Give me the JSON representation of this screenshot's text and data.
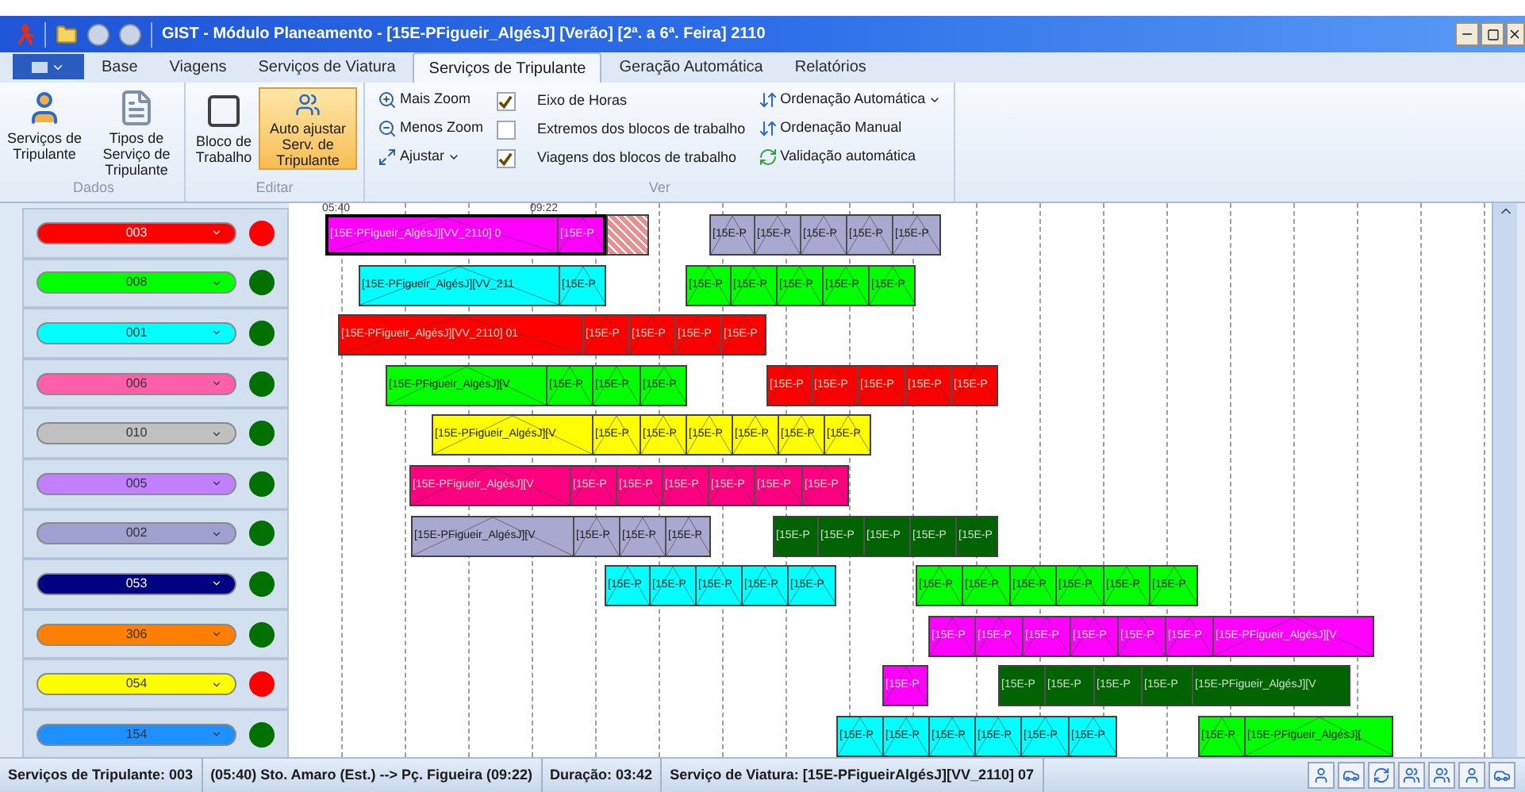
{
  "window": {
    "title": "GIST - Módulo Planeamento - [15E-PFigueir_AlgésJ] [Verão] [2ª. a 6ª. Feira] 2110"
  },
  "tabs": [
    {
      "label": "Base",
      "selected": false
    },
    {
      "label": "Viagens",
      "selected": false
    },
    {
      "label": "Serviços de Viatura",
      "selected": false
    },
    {
      "label": "Serviços de Tripulante",
      "selected": true
    },
    {
      "label": "Geração Automática",
      "selected": false
    },
    {
      "label": "Relatórios",
      "selected": false
    }
  ],
  "data_group": {
    "label": "Dados",
    "buttons": [
      {
        "label": "Serviços de Tripulante"
      },
      {
        "label": "Tipos de Serviço de Tripulante"
      }
    ]
  },
  "edit_group": {
    "label": "Editar",
    "buttons": [
      {
        "label": "Bloco de Trabalho",
        "selected": false
      },
      {
        "label": "Auto ajustar Serv. de Tripulante",
        "selected": true
      }
    ]
  },
  "view_group": {
    "label": "Ver",
    "tools": [
      {
        "label": "Mais Zoom",
        "menu": false
      },
      {
        "label": "Menos Zoom",
        "menu": false
      },
      {
        "label": "Ajustar",
        "menu": true
      }
    ],
    "options": [
      {
        "label": "Eixo de Horas",
        "checked": true
      },
      {
        "label": "Extremos dos blocos de trabalho",
        "checked": false
      },
      {
        "label": "Viagens dos blocos de trabalho",
        "checked": true
      }
    ],
    "commands": [
      {
        "label": "Ordenação Automática",
        "menu": true
      },
      {
        "label": "Ordenação Manual",
        "menu": false
      },
      {
        "label": "Validação automática",
        "menu": false
      }
    ]
  },
  "timeline": {
    "marks": [
      "05:40",
      "09:22"
    ]
  },
  "crew_rows": [
    {
      "label": "003",
      "color": "#ff0000",
      "status": {
        "color": "#ff0000"
      },
      "blocks": [
        {
          "kind": "trips",
          "color": "#ff00ff",
          "selected": true,
          "segments": [
            "[15E-PFigueir_AlgésJ][VV_2110] 0",
            "[15E-P"
          ]
        },
        {
          "kind": "hatched",
          "color": "#e89090",
          "selected": false
        },
        {
          "kind": "trips",
          "color": "#a8a8d0",
          "selected": false,
          "segments": [
            "[15E-P",
            "[15E-P",
            "[15E-P",
            "[15E-P",
            "[15E-P"
          ]
        }
      ]
    },
    {
      "label": "008",
      "color": "#00ff00",
      "status": {
        "color": "#007000"
      },
      "blocks": [
        {
          "kind": "trips",
          "color": "#00ffff",
          "selected": false,
          "segments": [
            "[15E-PFigueir_AlgésJ][VV_211",
            "[15E-P"
          ]
        },
        {
          "kind": "trips",
          "color": "#00ff00",
          "selected": false,
          "segments": [
            "[15E-P",
            "[15E-P",
            "[15E-P",
            "[15E-P",
            "[15E-P"
          ]
        }
      ]
    },
    {
      "label": "001",
      "color": "#00ffff",
      "status": {
        "color": "#007000"
      },
      "blocks": [
        {
          "kind": "trips",
          "color": "#ff0000",
          "selected": false,
          "segments": [
            "[15E-PFigueir_AlgésJ][VV_2110] 01",
            "[15E-P",
            "[15E-P",
            "[15E-P",
            "[15E-P"
          ]
        }
      ]
    },
    {
      "label": "006",
      "color": "#ff5fa8",
      "status": {
        "color": "#007000"
      },
      "blocks": [
        {
          "kind": "trips",
          "color": "#00ff00",
          "selected": false,
          "segments": [
            "[15E-PFigueir_AlgésJ][V",
            "[15E-P",
            "[15E-P",
            "[15E-P"
          ]
        },
        {
          "kind": "trips",
          "color": "#ff0000",
          "selected": false,
          "segments": [
            "[15E-P",
            "[15E-P",
            "[15E-P",
            "[15E-P",
            "[15E-P"
          ]
        }
      ]
    },
    {
      "label": "010",
      "color": "#c0c0c0",
      "status": {
        "color": "#007000"
      },
      "blocks": [
        {
          "kind": "trips",
          "color": "#ffff00",
          "selected": false,
          "segments": [
            "[15E-PFigueir_AlgésJ][V",
            "[15E-P",
            "[15E-P",
            "[15E-P",
            "[15E-P",
            "[15E-P",
            "[15E-P"
          ]
        }
      ]
    },
    {
      "label": "005",
      "color": "#c080ff",
      "status": {
        "color": "#007000"
      },
      "blocks": [
        {
          "kind": "trips",
          "color": "#ff0080",
          "selected": false,
          "segments": [
            "[15E-PFigueir_AlgésJ][V",
            "[15E-P",
            "[15E-P",
            "[15E-P",
            "[15E-P",
            "[15E-P",
            "[15E-P"
          ]
        }
      ]
    },
    {
      "label": "002",
      "color": "#a0a0d0",
      "status": {
        "color": "#007000"
      },
      "blocks": [
        {
          "kind": "trips",
          "color": "#a8a8d0",
          "selected": false,
          "segments": [
            "[15E-PFigueir_AlgésJ][V",
            "[15E-P",
            "[15E-P",
            "[15E-P"
          ]
        },
        {
          "kind": "trips",
          "color": "#006400",
          "selected": false,
          "segments": [
            "[15E-P",
            "[15E-P",
            "[15E-P",
            "[15E-P",
            "[15E-P"
          ]
        }
      ]
    },
    {
      "label": "053",
      "color": "#000080",
      "status": {
        "color": "#007000"
      },
      "blocks": [
        {
          "kind": "trips",
          "color": "#00ffff",
          "selected": false,
          "segments": [
            "[15E-P",
            "[15E-P",
            "[15E-P",
            "[15E-P",
            "[15E-P"
          ]
        },
        {
          "kind": "trips",
          "color": "#00ff00",
          "selected": false,
          "segments": [
            "[15E-P",
            "[15E-P",
            "[15E-P",
            "[15E-P",
            "[15E-P",
            "[15E-P"
          ]
        }
      ]
    },
    {
      "label": "306",
      "color": "#ff8000",
      "status": {
        "color": "#007000"
      },
      "blocks": [
        {
          "kind": "trips",
          "color": "#ff00ff",
          "selected": false,
          "segments": [
            "[15E-P",
            "[15E-P",
            "[15E-P",
            "[15E-P",
            "[15E-P",
            "[15E-P",
            "[15E-PFigueir_AlgésJ][V"
          ]
        }
      ]
    },
    {
      "label": "054",
      "color": "#ffff00",
      "status": {
        "color": "#ff0000"
      },
      "blocks": [
        {
          "kind": "trips",
          "color": "#ff00ff",
          "selected": false,
          "segments": [
            "[15E-P"
          ]
        },
        {
          "kind": "trips",
          "color": "#006400",
          "selected": false,
          "segments": [
            "[15E-P",
            "[15E-P",
            "[15E-P",
            "[15E-P",
            "[15E-PFigueir_AlgésJ][V"
          ]
        }
      ]
    },
    {
      "label": "154",
      "color": "#1e90ff",
      "status": {
        "color": "#007000"
      },
      "blocks": [
        {
          "kind": "trips",
          "color": "#00ffff",
          "selected": false,
          "segments": [
            "[15E-P",
            "[15E-P",
            "[15E-P",
            "[15E-P",
            "[15E-P",
            "[15E-P"
          ]
        },
        {
          "kind": "trips",
          "color": "#00ff00",
          "selected": false,
          "segments": [
            "[15E-P",
            "[15E-PFigueir_AlgésJ]["
          ]
        }
      ]
    }
  ],
  "status_bar": [
    "Serviços de Tripulante: 003",
    "(05:40) Sto. Amaro (Est.) --> Pç. Figueira (09:22)",
    "Duração: 03:42",
    "Serviço de Viatura: [15E-PFigueirAlgésJ][VV_2110] 07"
  ]
}
